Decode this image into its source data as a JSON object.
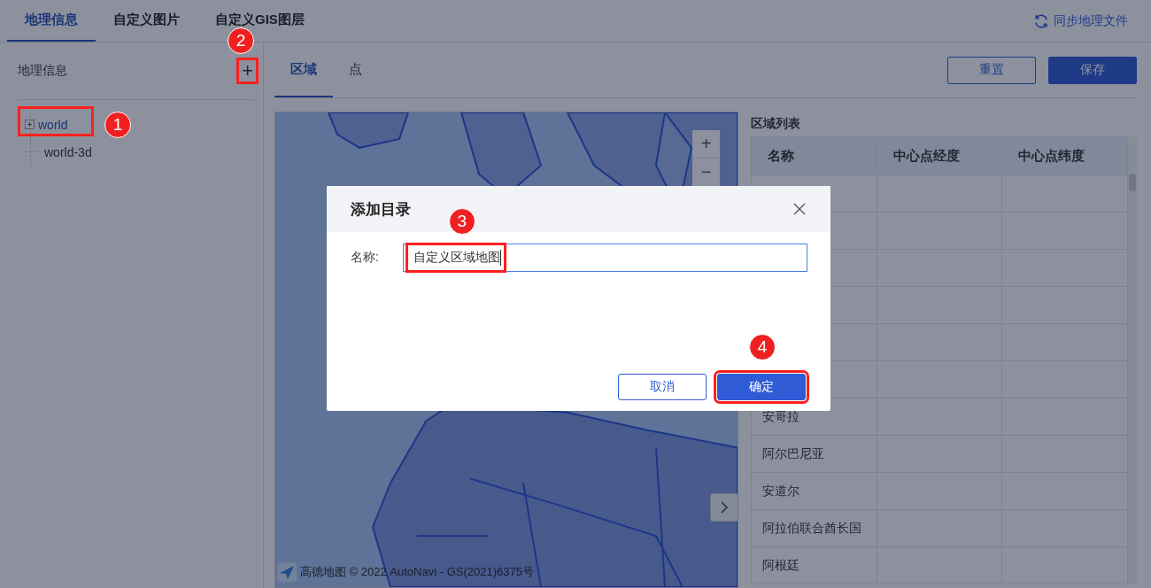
{
  "top_tabs": [
    {
      "label": "地理信息",
      "selected": true
    },
    {
      "label": "自定义图片",
      "selected": false
    },
    {
      "label": "自定义GIS图层",
      "selected": false
    }
  ],
  "sync_button": {
    "label": "同步地理文件"
  },
  "sidebar": {
    "title": "地理信息",
    "add_button": {
      "label": "+",
      "highlighted": true,
      "badge": "2"
    },
    "items": [
      {
        "label": "world",
        "expandable": true,
        "selected": true,
        "highlighted": true,
        "badge": "1"
      },
      {
        "label": "world-3d",
        "expandable": false,
        "selected": false,
        "highlighted": false
      }
    ]
  },
  "sub_tabs": [
    {
      "label": "区域",
      "selected": true
    },
    {
      "label": "点",
      "selected": false
    }
  ],
  "actions": [
    {
      "label": "重置",
      "kind": "secondary"
    },
    {
      "label": "保存",
      "kind": "primary"
    }
  ],
  "map": {
    "kind": "picture",
    "zoom_in": "+",
    "zoom_out": "−",
    "attribution": "高德地图 © 2022 AutoNavi - GS(2021)6375号"
  },
  "region_list": {
    "title": "区域列表",
    "columns": [
      "名称",
      "中心点经度",
      "中心点纬度"
    ],
    "rows": [
      {
        "name": "安哥拉"
      },
      {
        "name": "阿尔巴尼亚"
      },
      {
        "name": "安道尔"
      },
      {
        "name": "阿拉伯联合酋长国"
      },
      {
        "name": "阿根廷"
      }
    ]
  },
  "dialog": {
    "title": "添加目录",
    "field_label": "名称:",
    "field_value": "自定义区域地图",
    "field_highlighted": true,
    "field_badge": "3",
    "buttons": [
      {
        "label": "取消",
        "kind": "secondary",
        "highlighted": false
      },
      {
        "label": "确定",
        "kind": "primary",
        "highlighted": true,
        "badge": "4"
      }
    ]
  }
}
